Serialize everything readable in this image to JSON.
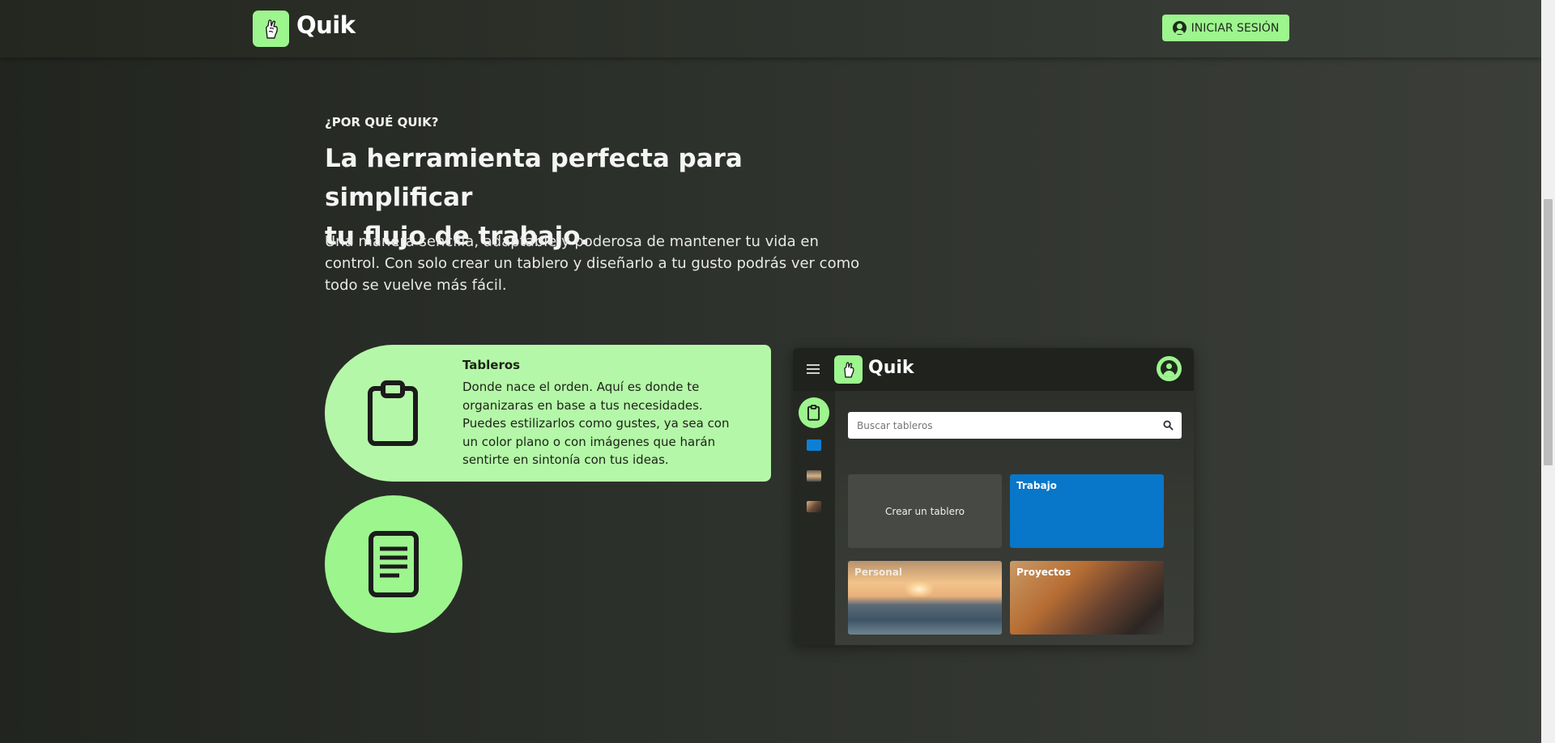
{
  "header": {
    "brand": "Quik",
    "login_label": "INICIAR SESIÓN",
    "icons": [
      "hand-logo-icon",
      "user-circle-icon"
    ]
  },
  "hero": {
    "eyebrow": "¿POR QUÉ QUIK?",
    "headline_line1": "La herramienta perfecta para simplificar",
    "headline_line2": "tu flujo de trabajo.",
    "lead_line1": "Una manera sencilla, adaptable y poderosa de mantener tu vida en",
    "lead_line2": "control. Con solo crear un tablero y diseñarlo a tu gusto podrás ver como",
    "lead_line3": "todo se vuelve más fácil."
  },
  "features": [
    {
      "title": "Tableros",
      "desc_lines": [
        "Donde nace el orden. Aquí es donde te",
        "organizaras en base a tus necesidades.",
        "Puedes estilizarlos como gustes, ya sea con",
        "un color plano o con imágenes que harán",
        "sentirte en sintonía con tus ideas."
      ],
      "icon": "clipboard-icon"
    },
    {
      "icon": "document-icon"
    }
  ],
  "mock": {
    "brand": "Quik",
    "search_placeholder": "Buscar tableros",
    "create_label": "Crear un tablero",
    "boards": [
      "Trabajo",
      "Personal",
      "Proyectos"
    ]
  },
  "colors": {
    "accent": "#9df58e",
    "accent_light": "#b5f7a8",
    "board_blue": "#0877c9"
  }
}
